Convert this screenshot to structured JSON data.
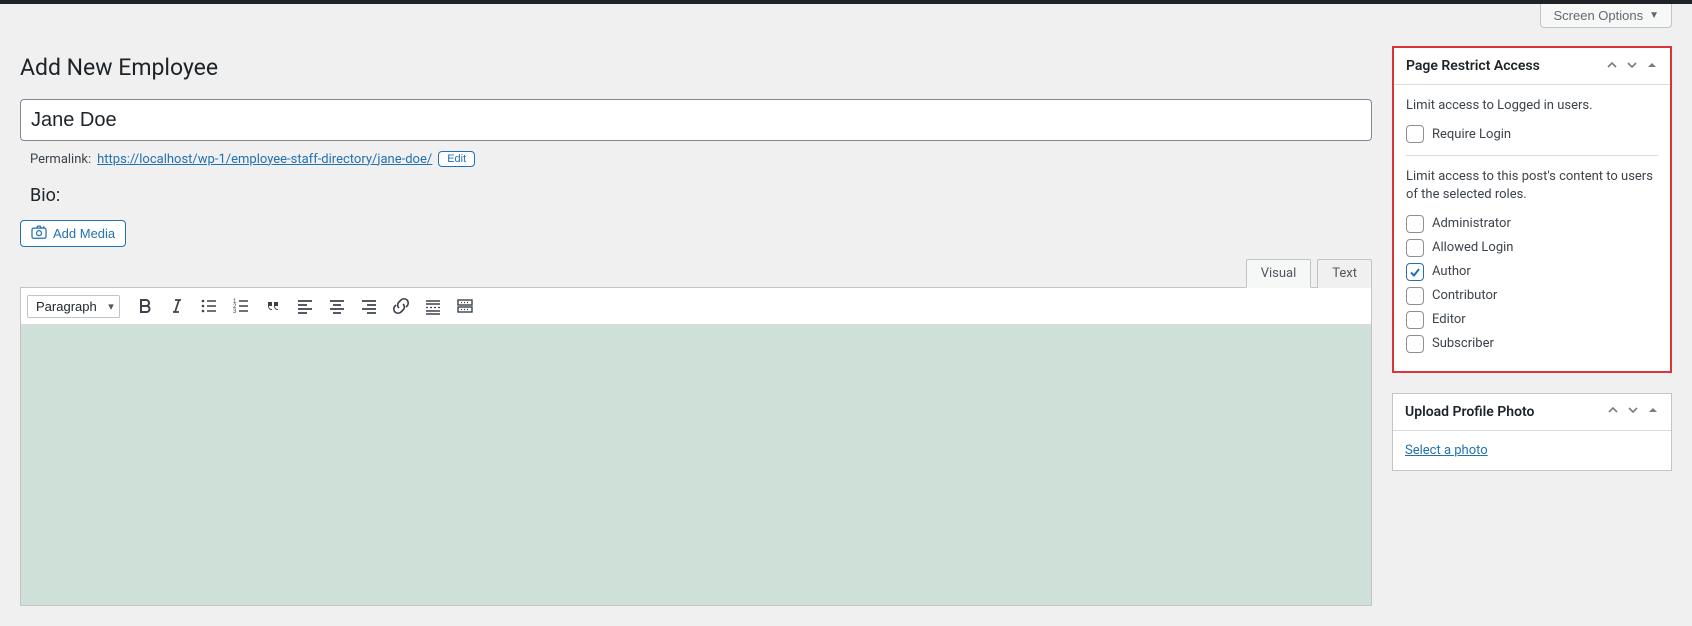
{
  "header": {
    "screen_options": "Screen Options",
    "page_title": "Add New Employee"
  },
  "post": {
    "title": "Jane Doe",
    "permalink_label": "Permalink:",
    "permalink_base": "https://localhost/wp-1/employee-staff-directory/",
    "permalink_slug": "jane-doe/",
    "edit_label": "Edit"
  },
  "bio": {
    "heading": "Bio:",
    "add_media": "Add Media",
    "tabs": {
      "visual": "Visual",
      "text": "Text"
    },
    "format_select": "Paragraph"
  },
  "restrict_panel": {
    "title": "Page Restrict Access",
    "desc1": "Limit access to Logged in users.",
    "require_login": "Require Login",
    "desc2": "Limit access to this post's content to users of the selected roles.",
    "roles": [
      {
        "label": "Administrator",
        "checked": false
      },
      {
        "label": "Allowed Login",
        "checked": false
      },
      {
        "label": "Author",
        "checked": true
      },
      {
        "label": "Contributor",
        "checked": false
      },
      {
        "label": "Editor",
        "checked": false
      },
      {
        "label": "Subscriber",
        "checked": false
      }
    ]
  },
  "photo_panel": {
    "title": "Upload Profile Photo",
    "link": "Select a photo"
  }
}
